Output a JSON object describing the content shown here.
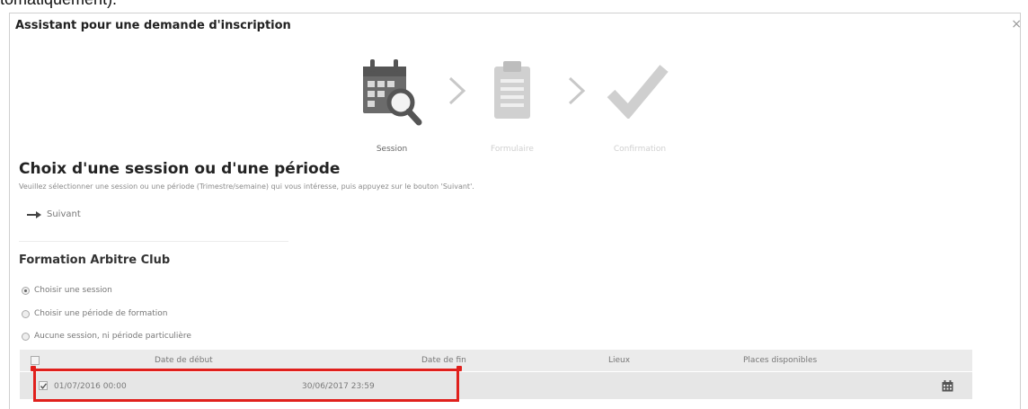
{
  "top_text": "tomatiquement).",
  "dialog": {
    "title": "Assistant pour une demande d'inscription",
    "close_label": "×"
  },
  "wizard": {
    "steps": [
      {
        "label": "Session",
        "icon": "calendar-search-icon",
        "active": true
      },
      {
        "label": "Formulaire",
        "icon": "clipboard-icon",
        "active": false
      },
      {
        "label": "Confirmation",
        "icon": "checkmark-icon",
        "active": false
      }
    ]
  },
  "section": {
    "title": "Choix d'une session ou d'une période",
    "instructions": "Veuillez sélectionner une session ou une période (Trimestre/semaine) qui vous intéresse, puis appuyez sur le bouton 'Suivant'.",
    "next_label": "Suivant"
  },
  "formation": {
    "title": "Formation Arbitre Club",
    "options": [
      {
        "label": "Choisir une session",
        "selected": true
      },
      {
        "label": "Choisir une période de formation",
        "selected": false
      },
      {
        "label": "Aucune session, ni période particulière",
        "selected": false
      }
    ]
  },
  "table": {
    "headers": [
      "Date de début",
      "Date de fin",
      "Lieux",
      "Places disponibles"
    ],
    "rows": [
      {
        "checked": true,
        "start": "01/07/2016 00:00",
        "end": "30/06/2017 23:59",
        "place": "",
        "available": ""
      }
    ]
  },
  "colors": {
    "highlight": "#e0201c",
    "icon_active": "#6b6b6b",
    "icon_inactive": "#cfcfcf"
  }
}
